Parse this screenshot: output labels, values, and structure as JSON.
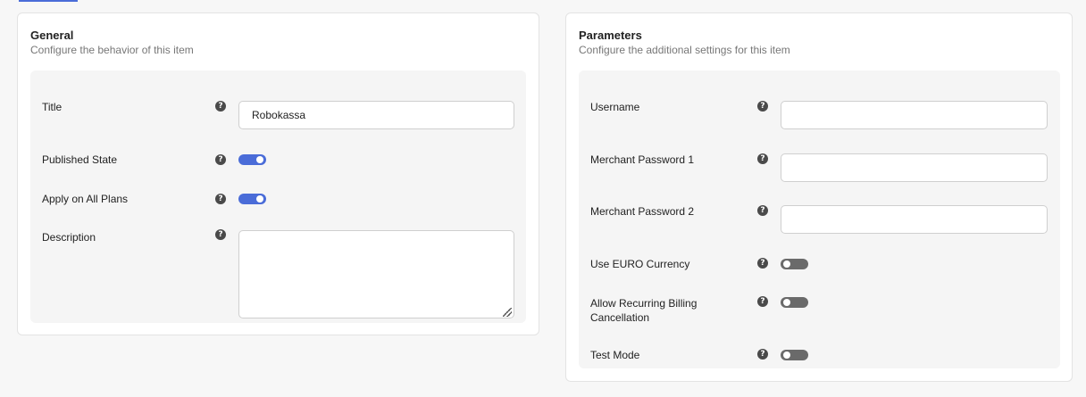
{
  "colors": {
    "accent": "#4a6cd8",
    "toggle_off": "#6a6a6a"
  },
  "general": {
    "title": "General",
    "subtitle": "Configure the behavior of this item",
    "fields": {
      "title_label": "Title",
      "title_value": "Robokassa",
      "published_label": "Published State",
      "published_on": true,
      "apply_all_label": "Apply on All Plans",
      "apply_all_on": true,
      "description_label": "Description",
      "description_value": ""
    }
  },
  "parameters": {
    "title": "Parameters",
    "subtitle": "Configure the additional settings for this item",
    "fields": {
      "username_label": "Username",
      "username_value": "",
      "merchant1_label": "Merchant Password 1",
      "merchant1_value": "",
      "merchant2_label": "Merchant Password 2",
      "merchant2_value": "",
      "euro_label": "Use EURO Currency",
      "euro_on": false,
      "recurring_label_1": "Allow Recurring Billing",
      "recurring_label_2": "Cancellation",
      "recurring_on": false,
      "test_label": "Test Mode",
      "test_on": false
    }
  },
  "icons": {
    "help": "question-circle-icon",
    "help_glyph": "?"
  }
}
